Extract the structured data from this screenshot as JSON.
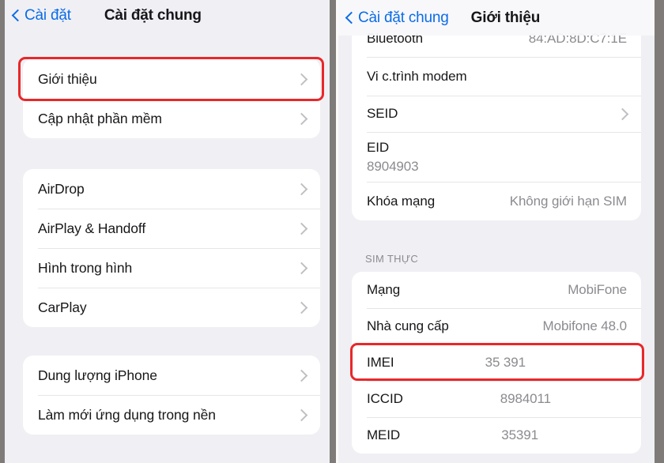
{
  "theme": {
    "background": "#f0f0f4",
    "card": "#ffffff",
    "accent_blue": "#0b6ce8",
    "value_gray": "#8b8b90",
    "highlight_red": "#e8272a",
    "chrome_gray": "#7e7b79"
  },
  "left_panel": {
    "nav": {
      "back_label": "Cài đặt",
      "title": "Cài đặt chung",
      "back_icon": "chevron-left-icon"
    },
    "group1": [
      {
        "label": "Giới thiệu",
        "accessory": "chevron-right-icon",
        "highlighted": true
      },
      {
        "label": "Cập nhật phần mềm",
        "accessory": "chevron-right-icon",
        "highlighted": false
      }
    ],
    "group2": [
      {
        "label": "AirDrop",
        "accessory": "chevron-right-icon"
      },
      {
        "label": "AirPlay & Handoff",
        "accessory": "chevron-right-icon"
      },
      {
        "label": "Hình trong hình",
        "accessory": "chevron-right-icon"
      },
      {
        "label": "CarPlay",
        "accessory": "chevron-right-icon"
      }
    ],
    "group3": [
      {
        "label": "Dung lượng iPhone",
        "accessory": "chevron-right-icon"
      },
      {
        "label": "Làm mới ứng dụng trong nền",
        "accessory": "chevron-right-icon"
      }
    ]
  },
  "right_panel": {
    "nav": {
      "back_label": "Cài đặt chung",
      "title": "Giới thiệu",
      "back_icon": "chevron-left-icon"
    },
    "group1": [
      {
        "label": "Bluetooth",
        "value": "84:AD:8D:C7:1E"
      },
      {
        "label": "Vi c.trình modem",
        "value": ""
      },
      {
        "label": "SEID",
        "value": "",
        "accessory": "chevron-right-icon"
      },
      {
        "label": "EID",
        "value": "8904903",
        "stacked": true
      },
      {
        "label": "Khóa mạng",
        "value": "Không giới hạn SIM"
      }
    ],
    "sim_section": {
      "header": "SIM THỰC",
      "rows": [
        {
          "label": "Mạng",
          "value": "MobiFone"
        },
        {
          "label": "Nhà cung cấp",
          "value": "Mobifone 48.0"
        },
        {
          "label": "IMEI",
          "value": "35 391",
          "highlighted": true
        },
        {
          "label": "ICCID",
          "value": "8984011"
        },
        {
          "label": "MEID",
          "value": "35391"
        }
      ]
    }
  }
}
